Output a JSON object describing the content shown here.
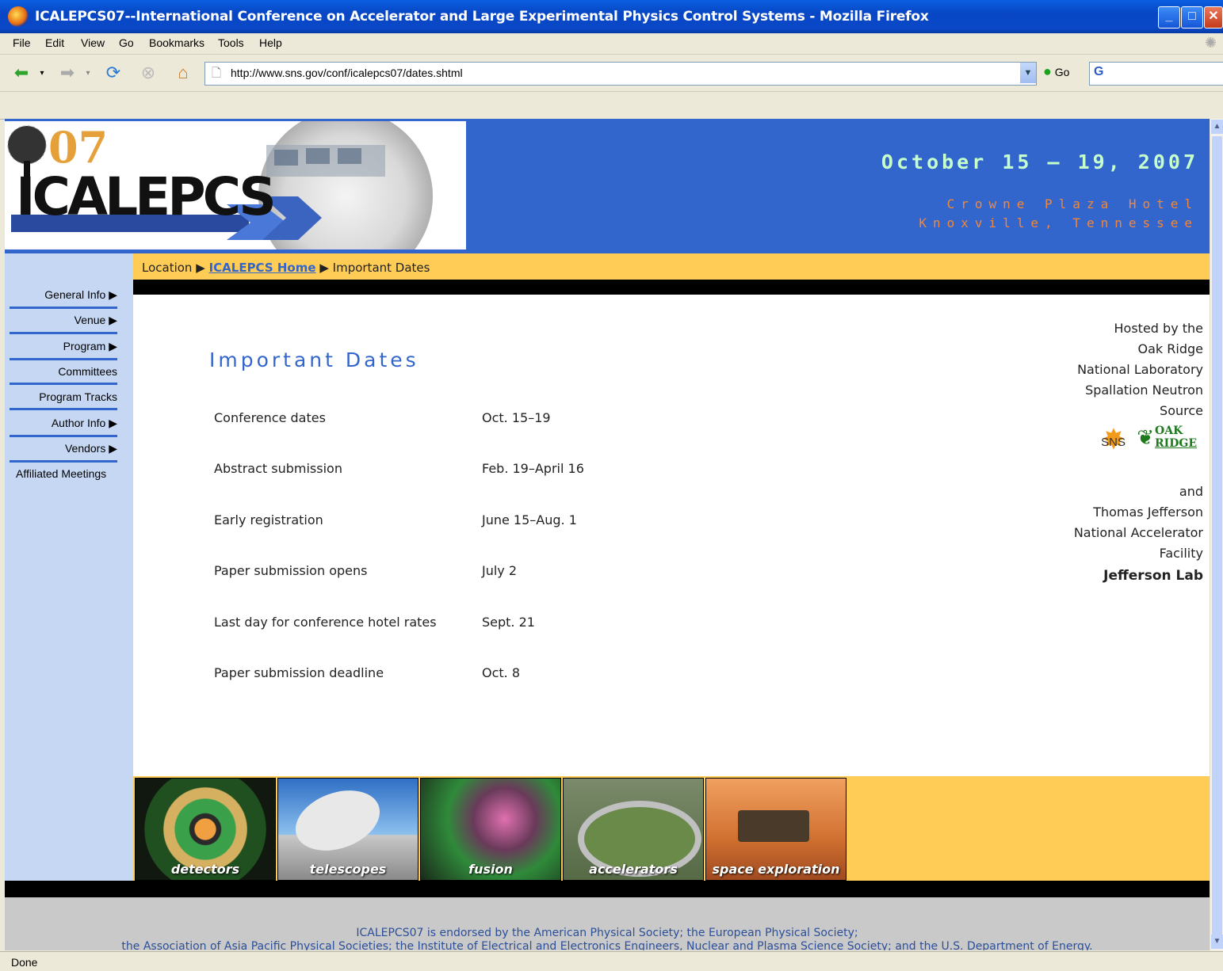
{
  "window": {
    "title": "ICALEPCS07--International Conference on Accelerator and Large Experimental Physics Control Systems - Mozilla Firefox"
  },
  "menu": [
    "File",
    "Edit",
    "View",
    "Go",
    "Bookmarks",
    "Tools",
    "Help"
  ],
  "toolbar": {
    "url": "http://www.sns.gov/conf/icalepcs07/dates.shtml",
    "go_label": "Go"
  },
  "header": {
    "logo_text": "ICALEPCS",
    "logo_year": "07",
    "dates": "October 15 – 19, 2007",
    "venue_line1": "Crowne Plaza Hotel",
    "venue_line2": "Knoxville, Tennessee"
  },
  "breadcrumb": {
    "location": "Location",
    "home": "ICALEPCS Home",
    "current": "Important Dates"
  },
  "sidebar": [
    {
      "label": "General Info",
      "arrow": true
    },
    {
      "label": "Venue",
      "arrow": true
    },
    {
      "label": "Program",
      "arrow": true
    },
    {
      "label": "Committees",
      "arrow": false
    },
    {
      "label": "Program Tracks",
      "arrow": false
    },
    {
      "label": "Author Info",
      "arrow": true
    },
    {
      "label": "Vendors",
      "arrow": true
    },
    {
      "label": "Affiliated Meetings",
      "arrow": false
    }
  ],
  "main": {
    "title": "Important Dates",
    "dates": [
      {
        "event": "Conference dates",
        "when": "Oct. 15–19"
      },
      {
        "event": "Abstract submission",
        "when": "Feb. 19–April 16"
      },
      {
        "event": "Early registration",
        "when": "June 15–Aug. 1"
      },
      {
        "event": "Paper submission opens",
        "when": "July 2"
      },
      {
        "event": "Last day for conference hotel rates",
        "when": "Sept. 21"
      },
      {
        "event": "Paper submission deadline",
        "when": "Oct. 8"
      }
    ]
  },
  "hosted": {
    "line1": "Hosted by the",
    "line2": "Oak Ridge",
    "line3": "National Laboratory",
    "line4": "Spallation Neutron",
    "line5": "Source",
    "sns_logo": "SNS",
    "ornl_logo_1": "OAK",
    "ornl_logo_2": "RIDGE",
    "and": "and",
    "line6": "Thomas Jefferson",
    "line7": "National Accelerator",
    "line8": "Facility",
    "jlab_logo": "Jefferson Lab"
  },
  "tiles": [
    "detectors",
    "telescopes",
    "fusion",
    "accelerators",
    "space exploration"
  ],
  "footer": {
    "line1": "ICALEPCS07 is endorsed by the American Physical Society; the European Physical Society;",
    "line2": "the Association of Asia Pacific Physical Societies; the Institute of Electrical and Electronics Engineers, Nuclear and Plasma Science Society; and the U.S. Department of Energy."
  },
  "status": "Done",
  "colors": {
    "header_blue": "#3366cc",
    "accent_yellow": "#ffcc55",
    "sidebar": "#c6d7f3",
    "date_green": "#c7ffcc",
    "venue_orange": "#f2873b"
  }
}
